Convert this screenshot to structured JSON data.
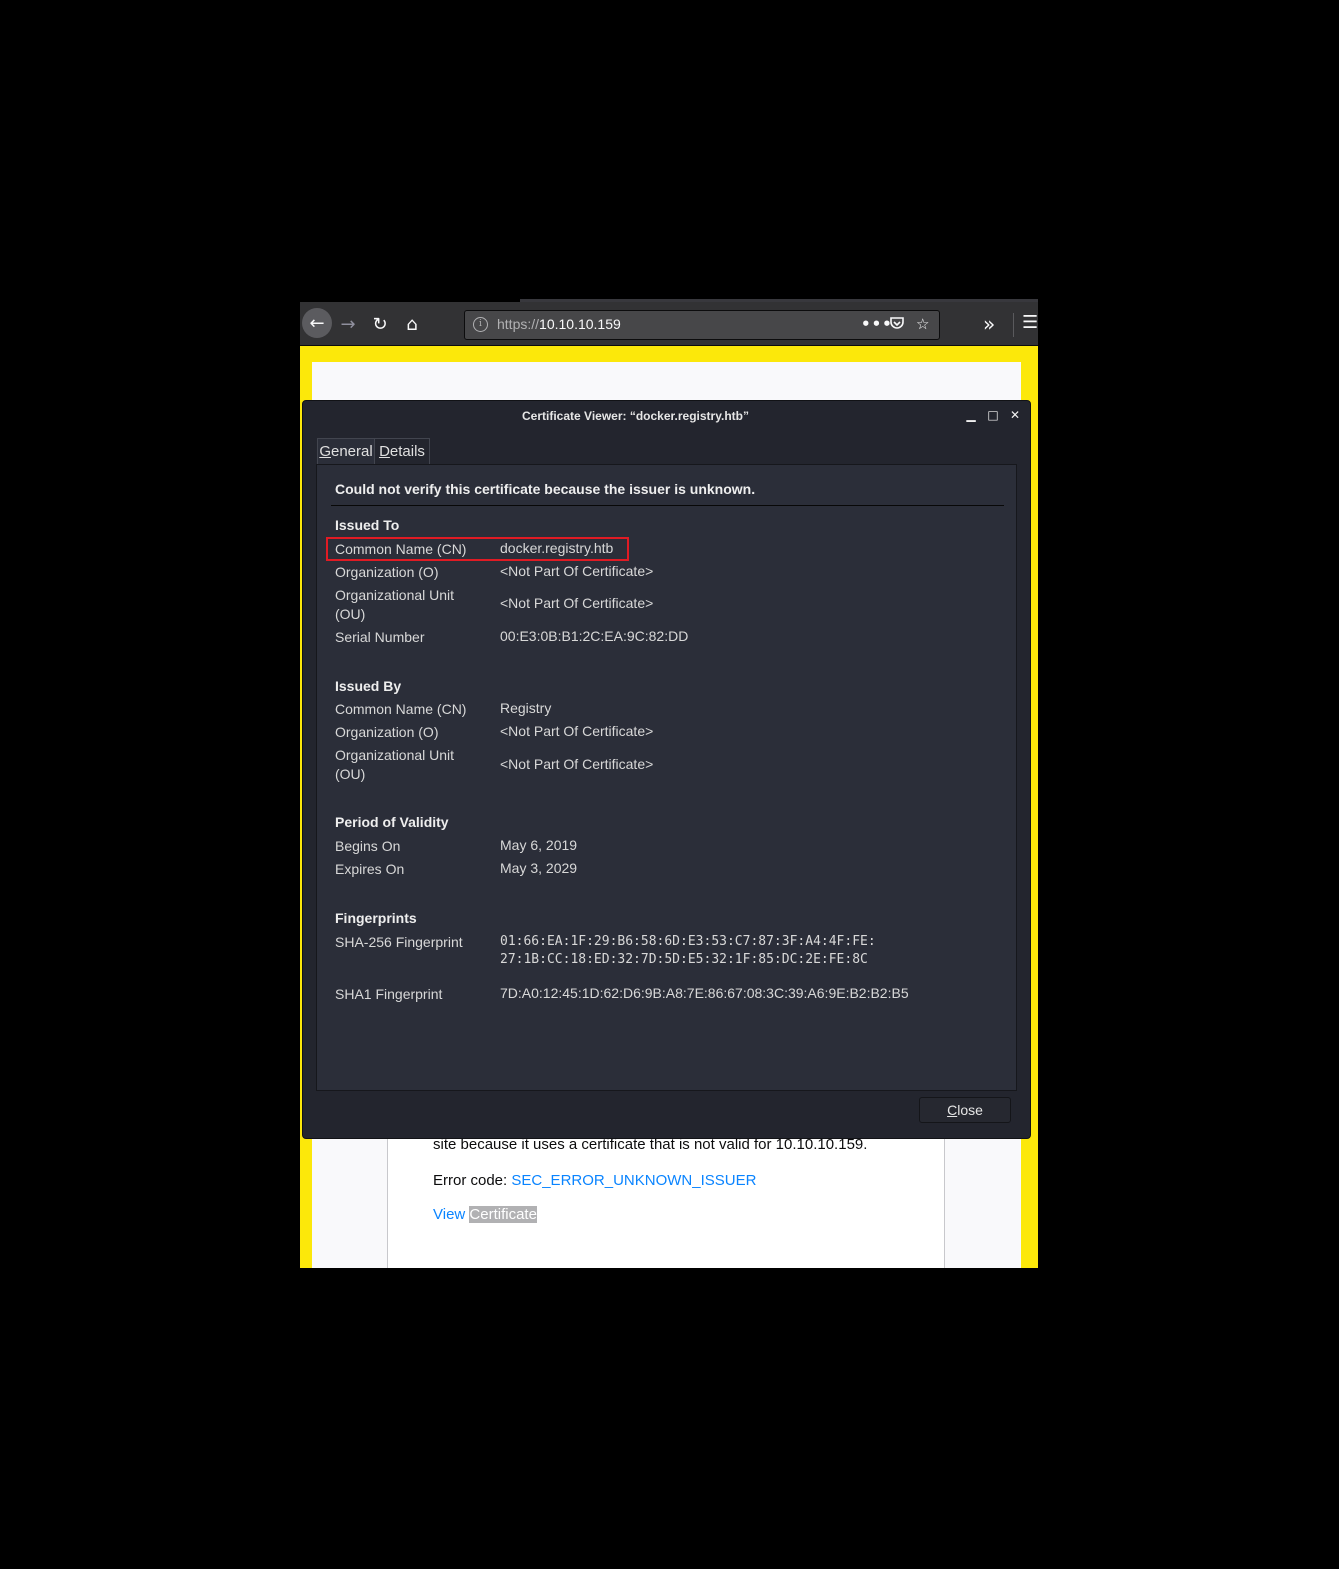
{
  "browser": {
    "url_scheme": "https://",
    "url_host": "10.10.10.159",
    "toolbar_icons": [
      "back-arrow-icon",
      "forward-arrow-icon",
      "reload-icon",
      "home-icon",
      "info-icon",
      "more-icon",
      "pocket-icon",
      "star-icon",
      "overflow-icon",
      "hamburger-menu-icon"
    ]
  },
  "error_page": {
    "description": "Websites prove their identity via certificates. Firefox does not trust this site because it uses a certificate that is not valid for 10.10.10.159.",
    "error_code_label": "Error code: ",
    "error_code": "SEC_ERROR_UNKNOWN_ISSUER",
    "view_label": "View ",
    "certificate_label": "Certificate",
    "background_color": "#fce80a"
  },
  "dialog": {
    "title": "Certificate Viewer: “docker.registry.htb”",
    "tabs": [
      {
        "label_underlined": "G",
        "label_rest": "eneral"
      },
      {
        "label_underlined": "D",
        "label_rest": "etails"
      }
    ],
    "warning": "Could not verify this certificate because the issuer is unknown.",
    "issued_to": {
      "heading": "Issued To",
      "rows": [
        {
          "label": "Common Name (CN)",
          "value": "docker.registry.htb"
        },
        {
          "label": "Organization (O)",
          "value": "<Not Part Of Certificate>"
        },
        {
          "label": "Organizational Unit (OU)",
          "value": "<Not Part Of Certificate>"
        },
        {
          "label": "Serial Number",
          "value": "00:E3:0B:B1:2C:EA:9C:82:DD"
        }
      ]
    },
    "issued_by": {
      "heading": "Issued By",
      "rows": [
        {
          "label": "Common Name (CN)",
          "value": "Registry"
        },
        {
          "label": "Organization (O)",
          "value": "<Not Part Of Certificate>"
        },
        {
          "label": "Organizational Unit (OU)",
          "value": "<Not Part Of Certificate>"
        }
      ]
    },
    "validity": {
      "heading": "Period of Validity",
      "rows": [
        {
          "label": "Begins On",
          "value": "May 6, 2019"
        },
        {
          "label": "Expires On",
          "value": "May 3, 2029"
        }
      ]
    },
    "fingerprints": {
      "heading": "Fingerprints",
      "sha256_label": "SHA-256 Fingerprint",
      "sha256_line1": "01:66:EA:1F:29:B6:58:6D:E3:53:C7:87:3F:A4:4F:FE:",
      "sha256_line2": "27:1B:CC:18:ED:32:7D:5D:E5:32:1F:85:DC:2E:FE:8C",
      "sha1_label": "SHA1 Fingerprint",
      "sha1_value": "7D:A0:12:45:1D:62:D6:9B:A8:7E:86:67:08:3C:39:A6:9E:B2:B2:B5"
    },
    "close_underlined": "C",
    "close_rest": "lose",
    "highlight_color": "#e01b24"
  }
}
